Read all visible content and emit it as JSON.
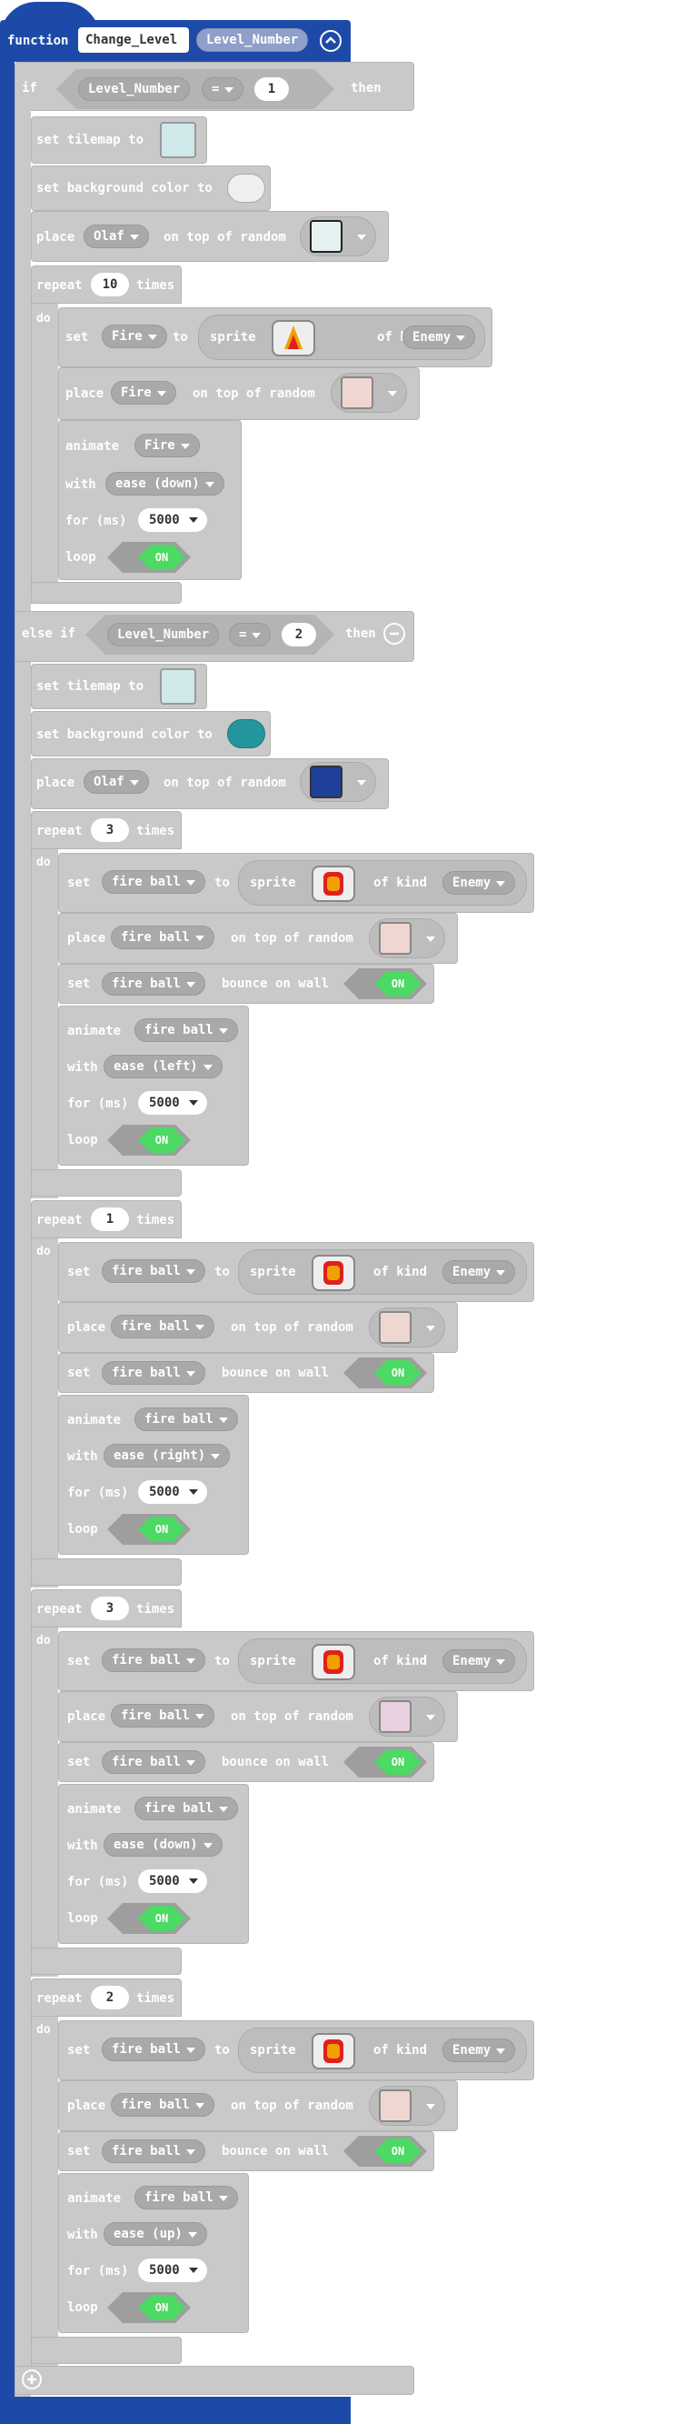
{
  "function": {
    "keyword": "function",
    "name": "Change_Level",
    "param": "Level_Number",
    "collapse_icon": "chevron-up-circle-icon"
  },
  "labels": {
    "if": "if",
    "then": "then",
    "else_if": "else if",
    "set_tilemap": "set tilemap to",
    "set_bg": "set background color to",
    "place": "place",
    "on_top_of_random": "on top of random",
    "repeat": "repeat",
    "times": "times",
    "do": "do",
    "set": "set",
    "to": "to",
    "sprite": "sprite",
    "of_kind": "of kind",
    "bounce_on_wall": "bounce on wall",
    "animate": "animate",
    "with": "with",
    "for_ms": "for (ms)",
    "loop": "loop"
  },
  "conditions": [
    {
      "var": "Level_Number",
      "op": "=",
      "value": "1"
    },
    {
      "var": "Level_Number",
      "op": "=",
      "value": "2"
    }
  ],
  "colors": {
    "function_blue": "#1d4aa8",
    "block_gray": "#c9c9c9",
    "bg_color_1": "#efefef",
    "bg_color_2": "#23969d",
    "toggle_green": "#4cd964"
  },
  "branch1": {
    "tilemap_icon": "tilemap-snow-icon",
    "bg_color": "#efefef",
    "place_sprite": "Olaf",
    "place_tile_icon": "ice-tile-icon",
    "repeat": {
      "count": "10",
      "set_var": "Fire",
      "sprite_icon": "flame-sprite-icon",
      "kind": "Enemy",
      "place_var": "Fire",
      "place_tile_icon": "pink-tile-icon",
      "animate_var": "Fire",
      "ease": "ease (down)",
      "ms": "5000",
      "loop": "ON"
    }
  },
  "branch2": {
    "tilemap_icon": "tilemap-maze-icon",
    "bg_color": "#23969d",
    "place_sprite": "Olaf",
    "place_tile_icon": "brick-tile-icon",
    "repeats": [
      {
        "count": "3",
        "set_var": "fire ball",
        "kind": "Enemy",
        "place_var": "fire ball",
        "bounce_var": "fire ball",
        "bounce": "ON",
        "animate_var": "fire ball",
        "ease": "ease (left)",
        "ms": "5000",
        "loop": "ON"
      },
      {
        "count": "1",
        "set_var": "fire ball",
        "kind": "Enemy",
        "place_var": "fire ball",
        "bounce_var": "fire ball",
        "bounce": "ON",
        "animate_var": "fire ball",
        "ease": "ease (right)",
        "ms": "5000",
        "loop": "ON"
      },
      {
        "count": "3",
        "set_var": "fire ball",
        "kind": "Enemy",
        "place_var": "fire ball",
        "bounce_var": "fire ball",
        "bounce": "ON",
        "animate_var": "fire ball",
        "ease": "ease (down)",
        "ms": "5000",
        "loop": "ON"
      },
      {
        "count": "2",
        "set_var": "fire ball",
        "kind": "Enemy",
        "place_var": "fire ball",
        "bounce_var": "fire ball",
        "bounce": "ON",
        "animate_var": "fire ball",
        "ease": "ease (up)",
        "ms": "5000",
        "loop": "ON"
      }
    ]
  },
  "add_icon": "plus-circle-icon",
  "remove_icon": "minus-circle-icon"
}
